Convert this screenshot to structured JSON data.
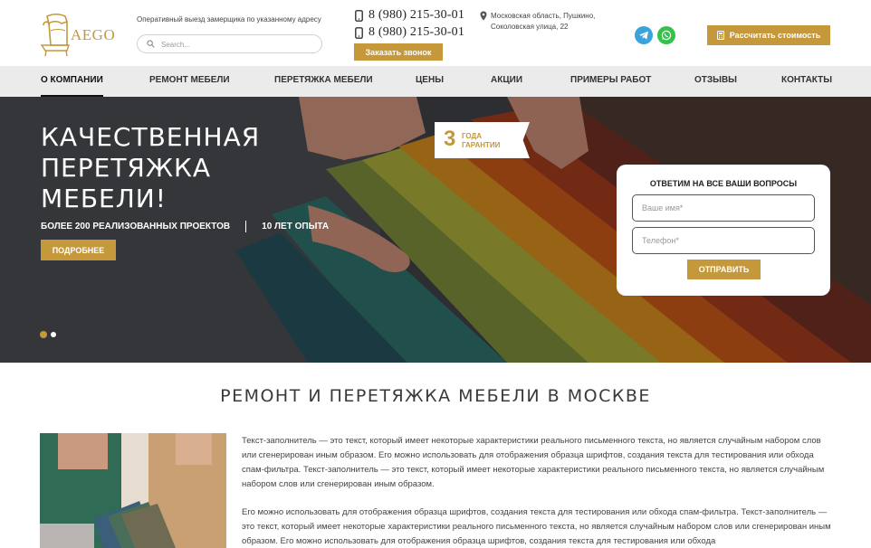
{
  "header": {
    "logo_text": "AEGO",
    "tagline": "Оперативный выезд замерщика по указанному адресу",
    "search": {
      "placeholder": "Search..."
    },
    "phones": [
      "8 (980) 215-30-01",
      "8 (980) 215-30-01"
    ],
    "callback_label": "Заказать звонок",
    "address": "Московская область, Пушкино, Соколовская улица, 22",
    "calc_label": "Рассчитать стоимость",
    "icons": [
      "search-icon",
      "phone-icon",
      "location-icon",
      "telegram-icon",
      "whatsapp-icon",
      "calculator-icon"
    ],
    "colors": {
      "accent": "#c4983b",
      "telegram": "#3aa3dc",
      "whatsapp": "#36c24a"
    }
  },
  "nav": {
    "items": [
      {
        "label": "О компании",
        "active": true
      },
      {
        "label": "Ремонт мебели"
      },
      {
        "label": "Перетяжка мебели"
      },
      {
        "label": "Цены"
      },
      {
        "label": "Акции"
      },
      {
        "label": "Примеры работ"
      },
      {
        "label": "Отзывы"
      },
      {
        "label": "Контакты"
      }
    ]
  },
  "hero": {
    "title": "КАЧЕСТВЕННАЯ ПЕРЕТЯЖКА МЕБЕЛИ!",
    "stats": [
      "БОЛЕЕ 200 РЕАЛИЗОВАННЫХ ПРОЕКТОВ",
      "10 ЛЕТ ОПЫТА"
    ],
    "more_label": "ПОДРОБНЕЕ",
    "badge": {
      "number": "3",
      "text": "ГОДА ГАРАНТИИ"
    },
    "slides_total": 2,
    "slide_active": 1
  },
  "form": {
    "title": "ОТВЕТИМ НА ВСЕ ВАШИ ВОПРОСЫ",
    "name_placeholder": "Ваше имя*",
    "phone_placeholder": "Телефон*",
    "submit_label": "ОТПРАВИТЬ"
  },
  "content": {
    "title": "РЕМОНТ И ПЕРЕТЯЖКА МЕБЕЛИ В МОСКВЕ",
    "paragraphs": [
      "Текст-заполнитель — это текст, который имеет некоторые характеристики реального письменного текста, но является случайным набором слов или сгенерирован иным образом. Его можно использовать для отображения образца шрифтов, создания текста для тестирования или обхода спам-фильтра. Текст-заполнитель — это текст, который имеет некоторые характеристики реального письменного текста, но является случайным набором слов или сгенерирован иным образом.",
      "Его можно использовать для отображения образца шрифтов, создания текста для тестирования или обхода спам-фильтра. Текст-заполнитель — это текст, который имеет некоторые характеристики реального письменного текста, но является случайным набором слов или сгенерирован иным образом. Его можно использовать для отображения образца шрифтов, создания текста для тестирования или обхода"
    ]
  }
}
